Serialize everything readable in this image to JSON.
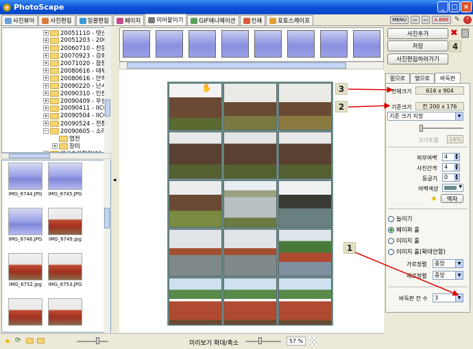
{
  "window": {
    "title": "PhotoScape",
    "min": "_",
    "max": "□",
    "close": "×"
  },
  "tabs": [
    {
      "label": "사진뷰어",
      "color": "#6aa0d8",
      "active": false
    },
    {
      "label": "사진편집",
      "color": "#d87a3a",
      "active": false
    },
    {
      "label": "일괄편집",
      "color": "#3a9ad8",
      "active": false
    },
    {
      "label": "페이지",
      "color": "#c04a8a",
      "active": false
    },
    {
      "label": "이어붙이기",
      "color": "#7a7a7a",
      "active": true
    },
    {
      "label": "GIF애니메이션",
      "color": "#5aa05a",
      "active": false
    },
    {
      "label": "인쇄",
      "color": "#d85a3a",
      "active": false
    },
    {
      "label": "포토스케이프",
      "color": "#e0a030",
      "active": false
    }
  ],
  "top_icons": [
    "MENU",
    "▭",
    "▭",
    "A.BBB"
  ],
  "tree": {
    "items": [
      {
        "label": "20051110 - 텟산",
        "expanded": false
      },
      {
        "label": "20051203 - 200",
        "expanded": false
      },
      {
        "label": "20060710 - 천문",
        "expanded": false
      },
      {
        "label": "20070923 - 강화",
        "expanded": false
      },
      {
        "label": "20071020 - 잠등",
        "expanded": false
      },
      {
        "label": "20080616 - 대부",
        "expanded": false
      },
      {
        "label": "20080616 - 안히",
        "expanded": false
      },
      {
        "label": "20090220 - 난시",
        "expanded": false
      },
      {
        "label": "20090310 - 인천",
        "expanded": false
      },
      {
        "label": "20090409 - 우성",
        "expanded": false
      },
      {
        "label": "20090411 - IICC",
        "expanded": false
      },
      {
        "label": "20090504 - IICC",
        "expanded": false
      },
      {
        "label": "20090524 - 전통",
        "expanded": false
      },
      {
        "label": "20090605 - 소래",
        "expanded": true
      },
      {
        "label": "염전",
        "expanded": null,
        "child": true
      },
      {
        "label": "장미",
        "expanded": false,
        "child": true
      },
      {
        "label": "연구추가학위(21",
        "expanded": false
      }
    ]
  },
  "thumbnails": [
    {
      "name": "IMG_6744.JPG",
      "kind": "blue"
    },
    {
      "name": "IMG_6745.JPG",
      "kind": "blue"
    },
    {
      "name": "IMG_6746.JPG",
      "kind": "blue"
    },
    {
      "name": "IMG_6749.jpg",
      "kind": "fence"
    },
    {
      "name": "IMG_6752.jpg",
      "kind": "fence"
    },
    {
      "name": "IMG_6753.JPG",
      "kind": "fence"
    },
    {
      "name": "",
      "kind": "fence"
    },
    {
      "name": "",
      "kind": "fence"
    }
  ],
  "filmstrip_count": 9,
  "right_panel": {
    "add_photo": "사진추가",
    "save": "저장",
    "go_edit": "사진편집하러가기",
    "tabs": [
      "밑으로",
      "옆으로",
      "바둑판"
    ],
    "active_tab": 2,
    "total_size_label": "전체크기",
    "total_size_value": "616 x 904",
    "base_size_label": "기준크기",
    "base_size_value": "칸 200 x 176",
    "base_size_select": "기준 크기 지정",
    "size_adjust_label": "크기조절",
    "size_adjust_value": "14%",
    "outer_margin_label": "외부여백",
    "outer_margin_value": "4",
    "spacing_label": "사진간격",
    "spacing_value": "4",
    "round_label": "둥글기",
    "round_value": "0",
    "margin_color_label": "여백색상",
    "frame_button": "액자",
    "radios": [
      {
        "label": "늘이기",
        "checked": false
      },
      {
        "label": "페이퍼 훌",
        "checked": true
      },
      {
        "label": "이미지 훌",
        "checked": false
      },
      {
        "label": "이미지 훌(확대안함)",
        "checked": false
      }
    ],
    "halign_label": "가로정렬",
    "halign_value": "중앙",
    "valign_label": "세로정렬",
    "valign_value": "중앙",
    "cols_label": "바둑판 칸 수",
    "cols_value": "3"
  },
  "annotations": [
    "1",
    "2",
    "3",
    "4"
  ],
  "annotation_color": "#dd0000",
  "bottom": {
    "zoom_label": "미리보기 확대/축소",
    "zoom_value": "57 %"
  }
}
